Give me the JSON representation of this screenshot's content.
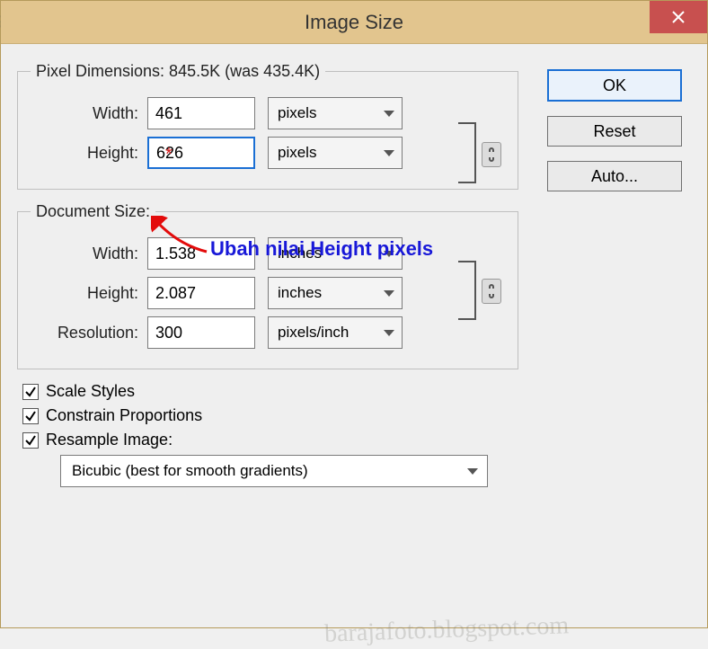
{
  "title": "Image Size",
  "close_icon": "close",
  "buttons": {
    "ok": "OK",
    "reset": "Reset",
    "auto": "Auto..."
  },
  "pixel": {
    "legend": "Pixel Dimensions:  845.5K (was 435.4K)",
    "width_label": "Width:",
    "width_value": "461",
    "width_unit": "pixels",
    "height_label": "Height:",
    "height_value": "626",
    "height_unit": "pixels"
  },
  "doc": {
    "legend": "Document Size:",
    "width_label": "Width:",
    "width_value": "1.538",
    "width_unit": "inches",
    "height_label": "Height:",
    "height_value": "2.087",
    "height_unit": "inches",
    "res_label": "Resolution:",
    "res_value": "300",
    "res_unit": "pixels/inch"
  },
  "checks": {
    "scale": "Scale Styles",
    "constrain": "Constrain Proportions",
    "resample": "Resample Image:"
  },
  "method": "Bicubic (best for smooth gradients)",
  "annotation": "Ubah nilai Height pixels",
  "watermark": "barajafoto.blogspot.com"
}
